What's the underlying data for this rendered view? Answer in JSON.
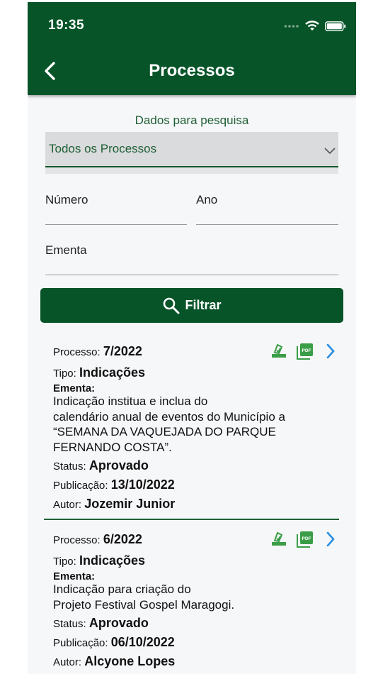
{
  "status_bar": {
    "time": "19:35"
  },
  "header": {
    "title": "Processos"
  },
  "search": {
    "heading": "Dados para pesquisa",
    "type_select_value": "Todos os Processos",
    "numero_label": "Número",
    "ano_label": "Ano",
    "ementa_label": "Ementa",
    "filter_button": "Filtrar"
  },
  "labels": {
    "processo": "Processo:",
    "tipo": "Tipo:",
    "ementa": "Ementa:",
    "status": "Status:",
    "publicacao": "Publicação:",
    "autor": "Autor:"
  },
  "processes": [
    {
      "numero": "7/2022",
      "tipo": "Indicações",
      "ementa_lines": [
        "Indicação institua e inclua do",
        "calendário anual de eventos do Município a",
        "“SEMANA DA VAQUEJADA DO PARQUE",
        "FERNANDO COSTA”."
      ],
      "status": "Aprovado",
      "publicacao": "13/10/2022",
      "autor": "Jozemir Junior"
    },
    {
      "numero": "6/2022",
      "tipo": "Indicações",
      "ementa_lines": [
        "Indicação para criação do",
        "Projeto Festival Gospel Maragogi."
      ],
      "status": "Aprovado",
      "publicacao": "06/10/2022",
      "autor": "Alcyone Lopes"
    }
  ],
  "icons": [
    "signal-dots-icon",
    "wifi-icon",
    "battery-icon",
    "back-arrow-icon",
    "chevron-down-icon",
    "search-icon",
    "vote-icon",
    "pdf-icon",
    "chevron-right-icon"
  ],
  "colors": {
    "primary": "#065428",
    "accent_green": "#3a9d47",
    "link_blue": "#2a8ee0",
    "background": "#f6f7f9"
  }
}
